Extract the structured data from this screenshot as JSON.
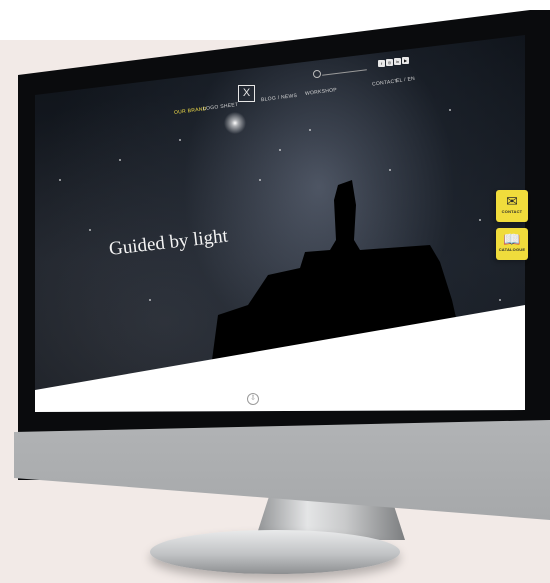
{
  "nav": {
    "left_items": [
      "OUR BRAND",
      "LOGO SHEET"
    ],
    "logo_mark": "X",
    "right_items": [
      "BLOG / NEWS",
      "WORKSHOP"
    ],
    "contact": "CONTACT",
    "language": "EL / EN"
  },
  "hero": {
    "title": "Guided by light",
    "scroll_icon": "⇩"
  },
  "social_icons": [
    "facebook-icon",
    "instagram-icon",
    "linkedin-icon",
    "youtube-icon"
  ],
  "side_tabs": [
    {
      "label": "CONTACT",
      "icon": "✉"
    },
    {
      "label": "CATALOGUE",
      "icon": "📖"
    }
  ],
  "colors": {
    "accent_yellow": "#f0dc3c",
    "active_nav": "#f5e04a"
  }
}
